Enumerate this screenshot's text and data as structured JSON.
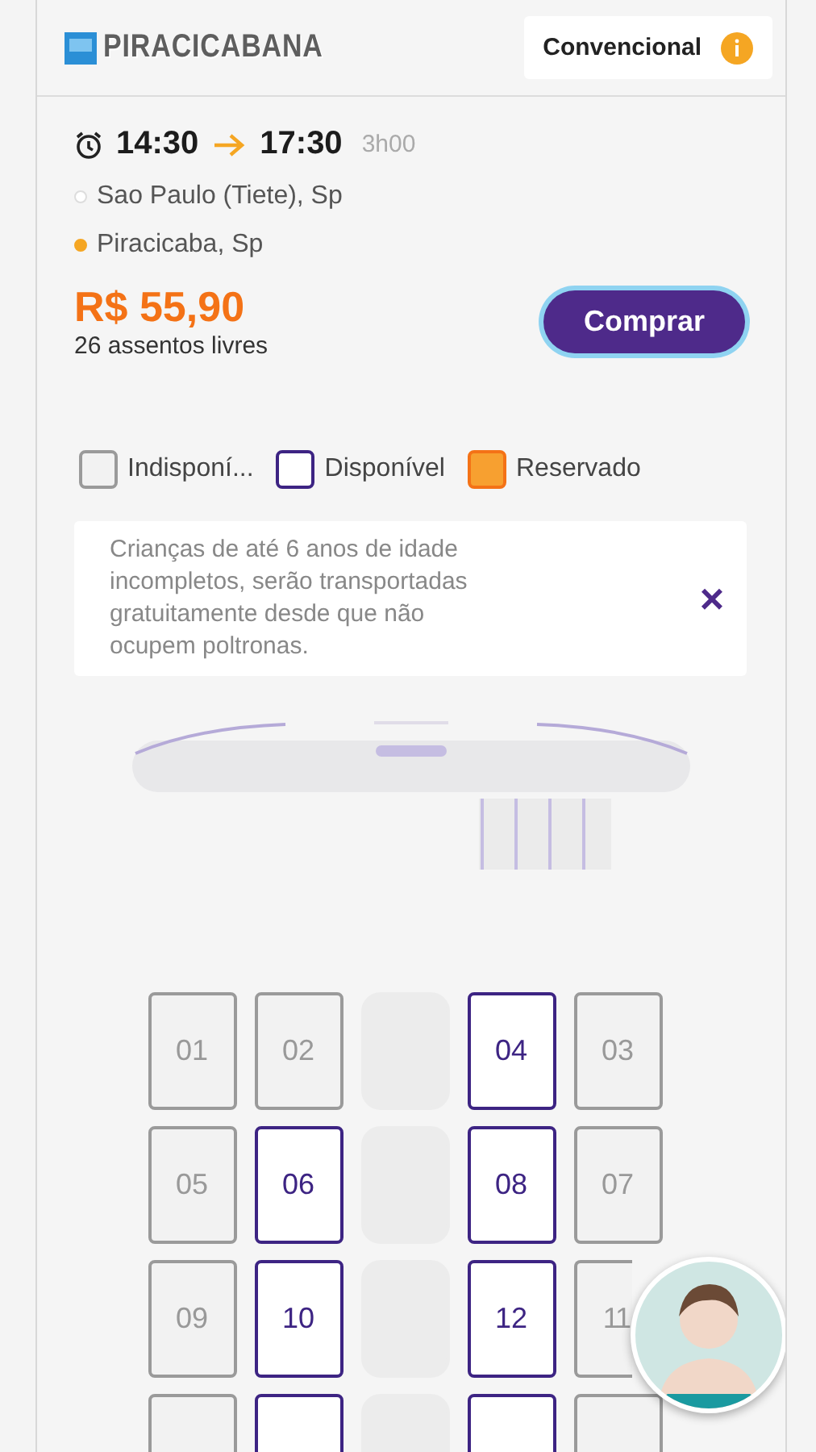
{
  "header": {
    "logo": "PIRACICABANA",
    "service_class": "Convencional"
  },
  "trip": {
    "departure": "14:30",
    "arrival": "17:30",
    "duration": "3h00",
    "origin": "Sao Paulo (Tiete), Sp",
    "destination": "Piracicaba, Sp",
    "price": "R$ 55,90",
    "free_seats": "26 assentos livres",
    "buy_button": "Comprar"
  },
  "legend": [
    {
      "kind": "unavailable",
      "label": "Indisponí..."
    },
    {
      "kind": "available",
      "label": "Disponível"
    },
    {
      "kind": "reserved",
      "label": "Reservado"
    }
  ],
  "notice": {
    "text": "Crianças de até 6 anos de idade incompletos, serão transportadas gratuitamente desde que não ocupem poltronas.",
    "close": "×"
  },
  "seat_rows": [
    [
      {
        "kind": "unavailable",
        "number": "01"
      },
      {
        "kind": "unavailable",
        "number": "02"
      },
      {
        "kind": "aisle"
      },
      {
        "kind": "available",
        "number": "04"
      },
      {
        "kind": "unavailable",
        "number": "03"
      }
    ],
    [
      {
        "kind": "unavailable",
        "number": "05"
      },
      {
        "kind": "available",
        "number": "06"
      },
      {
        "kind": "aisle"
      },
      {
        "kind": "available",
        "number": "08"
      },
      {
        "kind": "unavailable",
        "number": "07"
      }
    ],
    [
      {
        "kind": "unavailable",
        "number": "09"
      },
      {
        "kind": "available",
        "number": "10"
      },
      {
        "kind": "aisle"
      },
      {
        "kind": "available",
        "number": "12"
      },
      {
        "kind": "unavailable",
        "number": "11"
      }
    ],
    [
      {
        "kind": "unavailable"
      },
      {
        "kind": "available"
      },
      {
        "kind": "aisle"
      },
      {
        "kind": "available"
      },
      {
        "kind": "unavailable"
      }
    ]
  ]
}
